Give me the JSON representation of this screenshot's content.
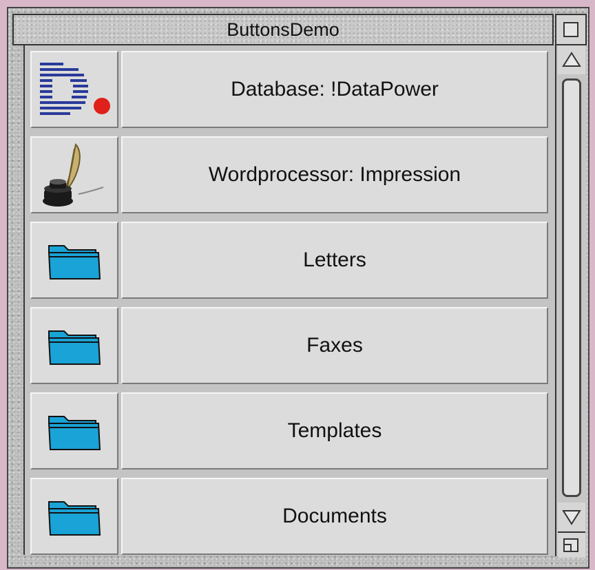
{
  "window": {
    "title": "ButtonsDemo"
  },
  "buttons": [
    {
      "label": "Database: !DataPower",
      "icon": "datapower-logo-icon"
    },
    {
      "label": "Wordprocessor: Impression",
      "icon": "quill-inkpot-icon"
    },
    {
      "label": "Letters",
      "icon": "folder-icon"
    },
    {
      "label": "Faxes",
      "icon": "folder-icon"
    },
    {
      "label": "Templates",
      "icon": "folder-icon"
    },
    {
      "label": "Documents",
      "icon": "folder-icon"
    }
  ],
  "colors": {
    "folder": "#1aa3d6",
    "logo_blue": "#2a3a9a",
    "logo_dot": "#e0201a"
  }
}
